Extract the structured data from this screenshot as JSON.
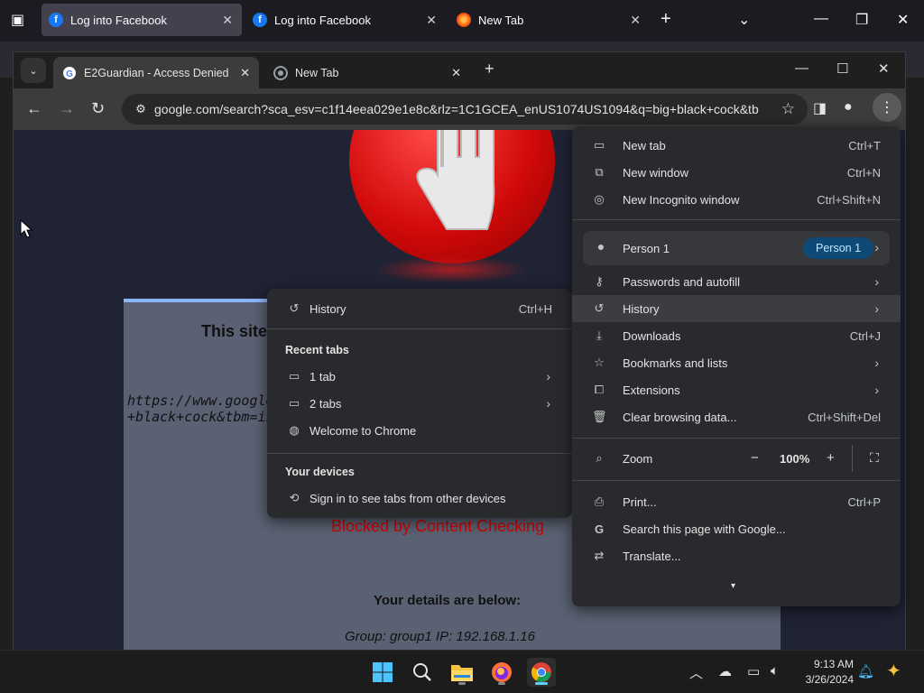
{
  "firefox": {
    "tabs": [
      {
        "title": "Log into Facebook",
        "active": true
      },
      {
        "title": "Log into Facebook",
        "active": false
      },
      {
        "title": "New Tab",
        "active": false
      }
    ],
    "new_tab_symbol": "+"
  },
  "chrome": {
    "tabs": [
      {
        "title": "E2Guardian - Access Denied",
        "active": true
      },
      {
        "title": "New Tab",
        "active": false
      }
    ],
    "url": "google.com/search?sca_esv=c1f14eea029e1e8c&rlz=1C1GCEA_enUS1074US1094&q=big+black+cock&tb...",
    "menu": {
      "items_top": [
        {
          "label": "New tab",
          "shortcut": "Ctrl+T",
          "icon": "new-tab-icon"
        },
        {
          "label": "New window",
          "shortcut": "Ctrl+N",
          "icon": "new-window-icon"
        },
        {
          "label": "New Incognito window",
          "shortcut": "Ctrl+Shift+N",
          "icon": "incognito-icon"
        }
      ],
      "profile": {
        "name": "Person 1",
        "badge": "Person 1"
      },
      "items_mid": [
        {
          "label": "Passwords and autofill",
          "shortcut": "",
          "icon": "key-icon",
          "submenu": true
        },
        {
          "label": "History",
          "shortcut": "",
          "icon": "history-icon",
          "submenu": true
        },
        {
          "label": "Downloads",
          "shortcut": "Ctrl+J",
          "icon": "download-icon",
          "submenu": false
        },
        {
          "label": "Bookmarks and lists",
          "shortcut": "",
          "icon": "star-icon",
          "submenu": true
        },
        {
          "label": "Extensions",
          "shortcut": "",
          "icon": "puzzle-icon",
          "submenu": true
        },
        {
          "label": "Clear browsing data...",
          "shortcut": "Ctrl+Shift+Del",
          "icon": "trash-icon",
          "submenu": false
        }
      ],
      "zoom": {
        "label": "Zoom",
        "value": "100%",
        "minus": "−",
        "plus": "+"
      },
      "items_bottom": [
        {
          "label": "Print...",
          "shortcut": "Ctrl+P",
          "icon": "print-icon"
        },
        {
          "label": "Search this page with Google...",
          "shortcut": "",
          "icon": "google-icon"
        },
        {
          "label": "Translate...",
          "shortcut": "",
          "icon": "translate-icon"
        }
      ]
    },
    "history_submenu": {
      "history": {
        "label": "History",
        "shortcut": "Ctrl+H"
      },
      "recent_tabs_heading": "Recent tabs",
      "recent": [
        {
          "label": "1 tab",
          "submenu": true
        },
        {
          "label": "2 tabs",
          "submenu": true
        },
        {
          "label": "Welcome to Chrome",
          "submenu": false
        }
      ],
      "devices_heading": "Your devices",
      "devices_item": "Sign in to see tabs from other devices"
    }
  },
  "page": {
    "title": "This site",
    "url_line1": "https://www.google.",
    "url_line2": "+black+cock&tbm=isch",
    "blocked": "Blocked by Content Checking",
    "details_heading": "Your details are below:",
    "group_line": "Group: group1   IP: 192.168.1.16"
  },
  "taskbar": {
    "time": "9:13 AM",
    "date": "3/26/2024"
  }
}
